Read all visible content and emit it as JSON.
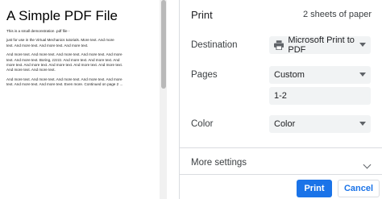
{
  "preview": {
    "doc_title": "A Simple PDF File",
    "paragraphs": [
      [
        "This is a small demonstration .pdf file -"
      ],
      [
        "just for use in the Virtual Mechanics tutorials. More text. And more",
        "text. And more text. And more text. And more text."
      ],
      [
        "And more text. And more text. And more text. And more text. And more",
        "text. And more text. Boring, zzzzz. And more text. And more text. And",
        "more text. And more text. And more text. And more text. And more text.",
        "And more text. And more text."
      ],
      [
        "And more text. And more text. And more text. And more text. And more",
        "text. And more text. And more text. Even more. Continued on page 2 ..."
      ]
    ]
  },
  "panel": {
    "title": "Print",
    "sheets": "2 sheets of paper",
    "destination": {
      "label": "Destination",
      "value": "Microsoft Print to PDF",
      "icon": "printer-icon"
    },
    "pages": {
      "label": "Pages",
      "value": "Custom",
      "custom_range": "1-2"
    },
    "color": {
      "label": "Color",
      "value": "Color"
    },
    "more_settings": {
      "label": "More settings",
      "icon": "chevron-down-icon"
    },
    "buttons": {
      "print": "Print",
      "cancel": "Cancel"
    },
    "accent_color": "#1a73e8"
  }
}
